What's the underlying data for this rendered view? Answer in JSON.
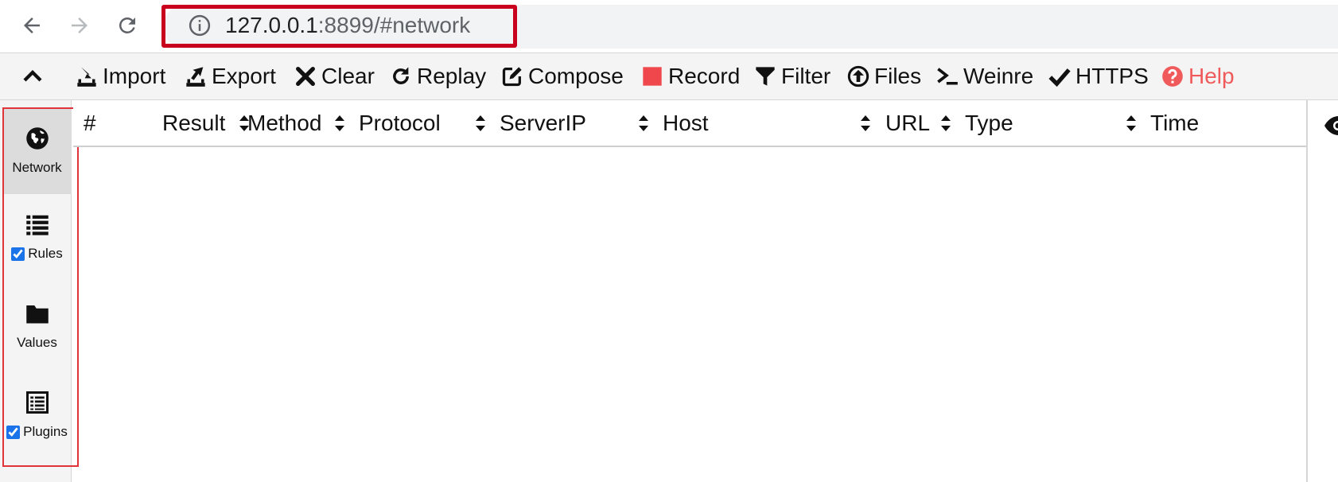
{
  "browser": {
    "url_host": "127.0.0.1",
    "url_path": ":8899/#network",
    "icons": [
      "back-arrow-icon",
      "forward-arrow-icon",
      "reload-icon",
      "info-icon"
    ]
  },
  "toolbar": {
    "items": [
      {
        "label": "Import",
        "icon": "import-icon"
      },
      {
        "label": "Export",
        "icon": "export-icon"
      },
      {
        "label": "Clear",
        "icon": "clear-icon"
      },
      {
        "label": "Replay",
        "icon": "replay-icon"
      },
      {
        "label": "Compose",
        "icon": "compose-icon"
      },
      {
        "label": "Record",
        "icon": "record-icon"
      },
      {
        "label": "Filter",
        "icon": "filter-icon"
      },
      {
        "label": "Files",
        "icon": "files-icon"
      },
      {
        "label": "Weinre",
        "icon": "terminal-icon"
      },
      {
        "label": "HTTPS",
        "icon": "check-icon"
      },
      {
        "label": "Help",
        "icon": "help-icon"
      }
    ]
  },
  "sidebar": {
    "items": [
      {
        "label": "Network",
        "icon": "globe-icon",
        "active": true,
        "checkbox": false
      },
      {
        "label": "Rules",
        "icon": "list-icon",
        "active": false,
        "checkbox": true,
        "checked": true
      },
      {
        "label": "Values",
        "icon": "folder-icon",
        "active": false,
        "checkbox": false
      },
      {
        "label": "Plugins",
        "icon": "plugins-icon",
        "active": false,
        "checkbox": true,
        "checked": true
      }
    ]
  },
  "table": {
    "columns": [
      "#",
      "Result",
      "Method",
      "Protocol",
      "ServerIP",
      "Host",
      "URL",
      "Type",
      "Time"
    ],
    "rows": []
  },
  "colors": {
    "highlight": "#c8001e",
    "record": "#f0474c",
    "help": "#f05a5a",
    "toolbar_bg": "#f4f4f4",
    "active_sidebar": "#dcdcdc"
  }
}
